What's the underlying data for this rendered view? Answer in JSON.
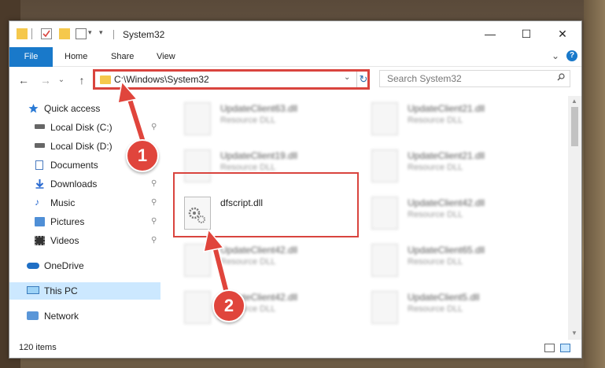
{
  "window": {
    "title": "System32",
    "minimize_glyph": "—",
    "maximize_glyph": "☐",
    "close_glyph": "✕"
  },
  "ribbon": {
    "tabs": [
      "File",
      "Home",
      "Share",
      "View"
    ],
    "expand_glyph": "⌄",
    "help_glyph": "?"
  },
  "address": {
    "path": "C:\\Windows\\System32",
    "back_glyph": "←",
    "forward_glyph": "→",
    "recent_glyph": "⌄",
    "up_glyph": "↑",
    "refresh_glyph": "↻",
    "dropdown_glyph": "⌄"
  },
  "search": {
    "placeholder": "Search System32"
  },
  "sidebar": {
    "items": [
      {
        "label": "Quick access",
        "icon": "star-icon",
        "pinned": false
      },
      {
        "label": "Local Disk (C:)",
        "icon": "drive-icon",
        "pinned": true
      },
      {
        "label": "Local Disk (D:)",
        "icon": "drive-icon",
        "pinned": true
      },
      {
        "label": "Documents",
        "icon": "document-icon",
        "pinned": true
      },
      {
        "label": "Downloads",
        "icon": "download-icon",
        "pinned": true
      },
      {
        "label": "Music",
        "icon": "music-icon",
        "pinned": true
      },
      {
        "label": "Pictures",
        "icon": "pictures-icon",
        "pinned": true
      },
      {
        "label": "Videos",
        "icon": "video-icon",
        "pinned": true
      },
      {
        "label": "OneDrive",
        "icon": "cloud-icon",
        "pinned": false
      },
      {
        "label": "This PC",
        "icon": "computer-icon",
        "pinned": false
      },
      {
        "label": "Network",
        "icon": "network-icon",
        "pinned": false
      }
    ],
    "pin_glyph": "📌"
  },
  "files": [
    {
      "name": "UpdateClient63.dll",
      "desc": "Resource DLL"
    },
    {
      "name": "UpdateClient21.dll",
      "desc": "Resource DLL"
    },
    {
      "name": "UpdateClient19.dll",
      "desc": "Resource DLL"
    },
    {
      "name": "UpdateClient21.dll",
      "desc": "Resource DLL"
    },
    {
      "name": "dfscript.dll",
      "desc": ""
    },
    {
      "name": "UpdateClient42.dll",
      "desc": "Resource DLL"
    },
    {
      "name": "UpdateClient42.dll",
      "desc": "Resource DLL"
    },
    {
      "name": "UpdateClient65.dll",
      "desc": "Resource DLL"
    },
    {
      "name": "UpdateClient42.dll",
      "desc": "Resource DLL"
    },
    {
      "name": "UpdateClient5.dll",
      "desc": "Resource DLL"
    }
  ],
  "status": {
    "item_count": "120 items"
  },
  "annotations": {
    "badge_1": "1",
    "badge_2": "2"
  },
  "colors": {
    "accent": "#1979ca",
    "highlight": "#d9443e",
    "selected": "#cce8ff"
  }
}
